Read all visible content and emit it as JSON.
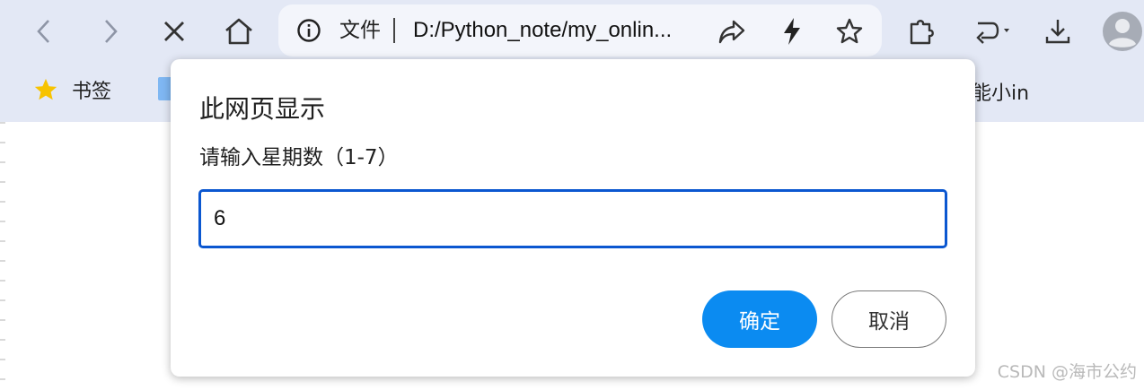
{
  "toolbar": {
    "back_icon": "chevron-left-icon",
    "forward_icon": "chevron-right-icon",
    "stop_icon": "close-icon",
    "home_icon": "home-icon",
    "extensions_icon": "puzzle-icon",
    "history_icon": "undo-dropdown-icon",
    "download_icon": "download-icon",
    "profile_icon": "avatar-icon"
  },
  "omnibox": {
    "info_icon": "info-icon",
    "scheme_label": "文件",
    "url": "D:/Python_note/my_onlin...",
    "share_icon": "share-icon",
    "lightning_icon": "lightning-icon",
    "favorite_icon": "star-outline-icon"
  },
  "bookmarks": {
    "folder_label": "书签",
    "partial_label": "能小in"
  },
  "dialog": {
    "title": "此网页显示",
    "message": "请输入星期数（1-7）",
    "input_value": "6",
    "ok_label": "确定",
    "cancel_label": "取消"
  },
  "watermark": "CSDN @海市公约",
  "colors": {
    "chrome_bg": "#e3e8f5",
    "omnibox_bg": "#f3f5fb",
    "focus_border": "#0b57d0",
    "primary_button": "#0b8bf1"
  }
}
